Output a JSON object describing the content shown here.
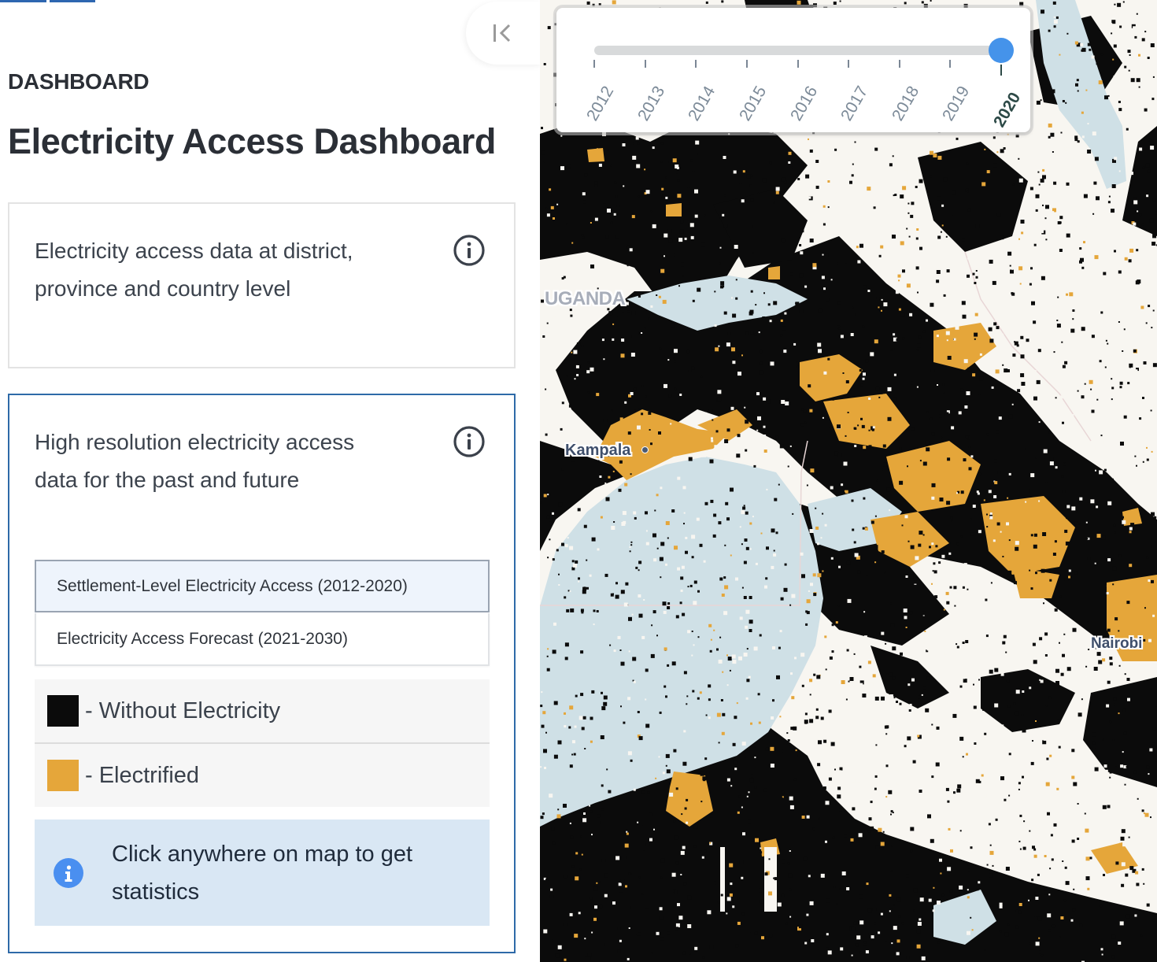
{
  "sidebar": {
    "collapse_icon": "collapse-left-icon",
    "eyebrow": "DASHBOARD",
    "title": "Electricity Access Dashboard",
    "cards": [
      {
        "description": "Electricity access data at district, province and country level",
        "info_icon": "info-circle-icon"
      },
      {
        "description": "High resolution electricity access data for the past and future",
        "info_icon": "info-circle-icon",
        "layer_options": [
          {
            "label": "Settlement-Level Electricity Access (2012-2020)",
            "selected": true
          },
          {
            "label": "Electricity Access Forecast (2021-2030)",
            "selected": false
          }
        ],
        "legend": [
          {
            "label": "- Without Electricity",
            "color": "#0b0b0b"
          },
          {
            "label": "- Electrified",
            "color": "#e5a63a"
          }
        ],
        "hint": {
          "icon": "info-filled-icon",
          "text": "Click anywhere on map to get statistics"
        }
      }
    ]
  },
  "map": {
    "labels": {
      "country": "UGANDA",
      "city_1": "Kampala",
      "city_2": "Nairobi"
    },
    "colors": {
      "no_access": "#0b0b0b",
      "electrified": "#e5a63a",
      "water": "#cfe0e6",
      "land": "#f8f6f1"
    }
  },
  "time_slider": {
    "years": [
      "2012",
      "2013",
      "2014",
      "2015",
      "2016",
      "2017",
      "2018",
      "2019",
      "2020"
    ],
    "selected_year": "2020",
    "selected_index": 8,
    "accent_color": "#4593ea"
  },
  "theme": {
    "primary": "#2e6aa8",
    "hint_bg": "#d9e7f4",
    "selected_option_bg": "#eef4fc"
  }
}
